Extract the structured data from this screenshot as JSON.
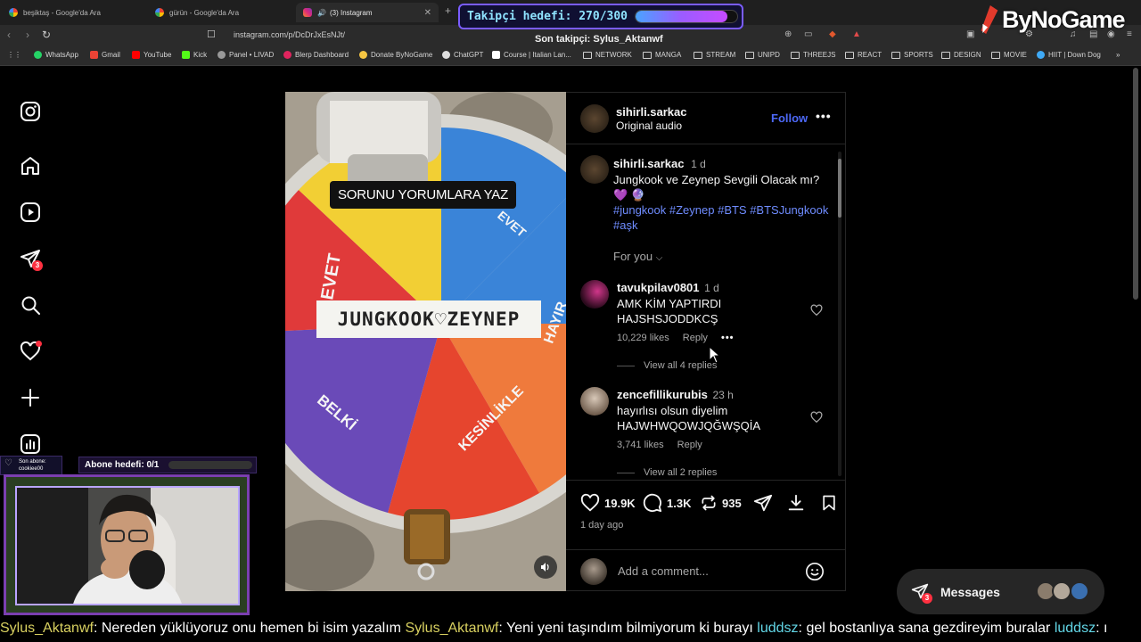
{
  "browser": {
    "tabs": [
      {
        "title": "beşiktaş - Google'da Ara",
        "icon": "google-icon"
      },
      {
        "title": "gürün - Google'da Ara",
        "icon": "google-icon"
      },
      {
        "title": "(3) Instagram",
        "icon": "instagram-icon",
        "active": true
      }
    ],
    "url": "instagram.com/p/DcDrJxEsNJt/",
    "bookmarks": [
      "WhatsApp",
      "Gmail",
      "YouTube",
      "Kick",
      "Panel • LIVAD",
      "Blerp Dashboard",
      "Donate ByNoGame",
      "ChatGPT",
      "Course | Italian Lan...",
      "NETWORK",
      "MANGA",
      "STREAM",
      "UNIPD",
      "THREEJS",
      "REACT",
      "SPORTS",
      "DESIGN",
      "MOVIE",
      "HIIT | Down Dog"
    ]
  },
  "overlay": {
    "follower_goal_label": "Takipçi hedefi: 270/300",
    "follower_goal_progress": 0.9,
    "last_follower": "Son takipçi: Sylus_Aktanwf",
    "brand": "ByNoGame",
    "sub_goal_label": "Abone hedefi: 0/1",
    "sub_goal_progress": 0,
    "last_sub_label": "Son abone:",
    "last_sub_name": "cookiee00"
  },
  "nav": {
    "notifications_badge": "3"
  },
  "post": {
    "media": {
      "sticker": "SORUNU YORUMLARA YAZ",
      "wheel_label": "JUNGKOOK♡ZEYNEP",
      "segments": [
        "EVET",
        "HAYIR",
        "BELKİ",
        "KESİNLİKLE",
        "EVET"
      ]
    },
    "author": "sihirli.sarkac",
    "audio": "Original audio",
    "follow_label": "Follow",
    "caption": {
      "user": "sihirli.sarkac",
      "age": "1 d",
      "text": "Jungkook ve Zeynep Sevgili Olacak mı?",
      "emoji": "💜 🔮",
      "hashtags_line1": "#jungkook #Zeynep #BTS #BTSJungkook",
      "hashtags_line2": "#aşk"
    },
    "sort_label": "For you",
    "comments": [
      {
        "user": "tavukpilav0801",
        "age": "1 d",
        "line1": "AMK KİM YAPTIRDI",
        "line2": "HAJSHSJODDKCŞ",
        "likes": "10,229 likes",
        "reply": "Reply",
        "view_replies": "View all 4 replies"
      },
      {
        "user": "zencefillikurubis",
        "age": "23 h",
        "line1": "hayırlısı olsun diyelim",
        "line2": "HAJWHWQOWJQĞWŞQİA",
        "likes": "3,741 likes",
        "reply": "Reply",
        "view_replies": "View all 2 replies"
      }
    ],
    "stats": {
      "likes": "19.9K",
      "comments": "1.3K",
      "reposts": "935"
    },
    "posted": "1 day ago",
    "add_comment_placeholder": "Add a comment..."
  },
  "messages": {
    "label": "Messages",
    "badge": "3"
  },
  "chat_ticker": [
    {
      "user": "Sylus_Aktanwf",
      "text": "Nereden yüklüyoruz onu hemen bi isim yazalım"
    },
    {
      "user": "Sylus_Aktanwf",
      "text": "Yeni yeni taşındım bilmiyorum ki burayı"
    },
    {
      "user": "luddsz",
      "text": "gel bostanlıya sana gezdireyim buralar"
    },
    {
      "user": "luddsz",
      "text": "ı"
    }
  ],
  "colors": {
    "accent_follow": "#4c68f6",
    "badge_red": "#ff3040",
    "hashtag": "#6f8cff",
    "goal_border": "#7a5cff"
  }
}
